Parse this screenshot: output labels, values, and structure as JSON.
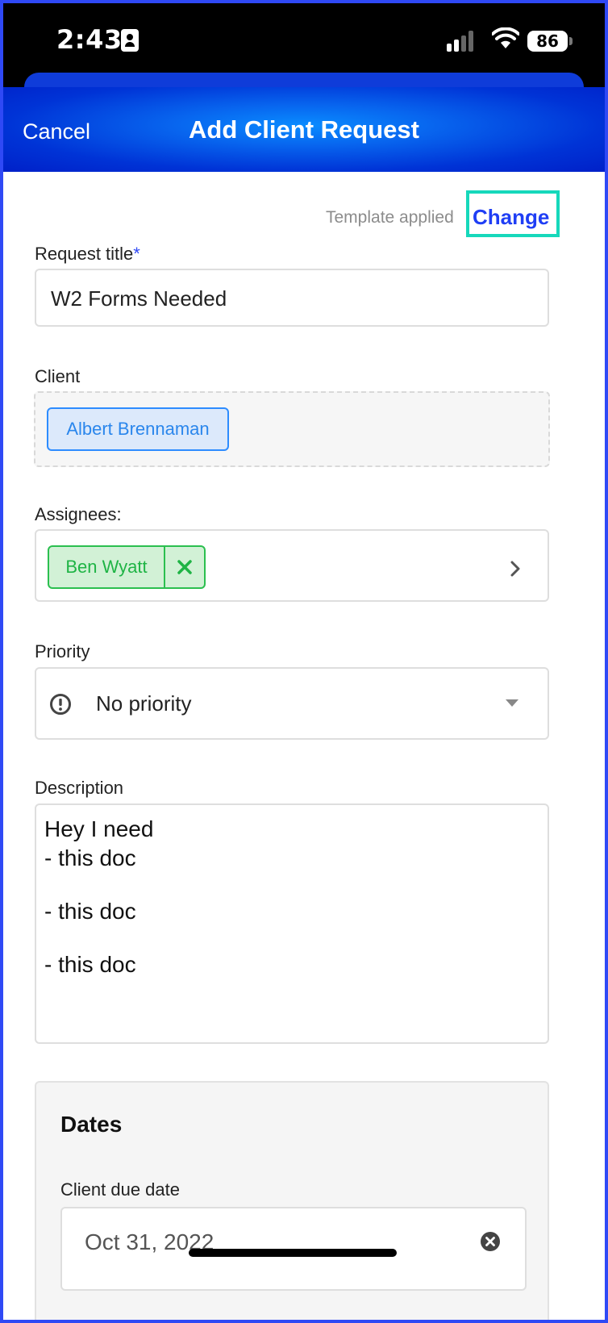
{
  "status_bar": {
    "time": "2:43",
    "battery": "86"
  },
  "header": {
    "cancel_label": "Cancel",
    "title": "Add Client Request"
  },
  "template": {
    "applied_text": "Template applied",
    "change_label": "Change"
  },
  "request_title": {
    "label": "Request title",
    "required_mark": "*",
    "value": "W2 Forms Needed"
  },
  "client": {
    "label": "Client",
    "selected": "Albert Brennaman"
  },
  "assignees": {
    "label": "Assignees:",
    "items": [
      {
        "name": "Ben Wyatt"
      }
    ]
  },
  "priority": {
    "label": "Priority",
    "value": "No priority"
  },
  "description": {
    "label": "Description",
    "lines": [
      "Hey I need",
      "- this doc",
      "",
      "- this doc",
      "",
      "- this doc"
    ]
  },
  "dates": {
    "title": "Dates",
    "client_due_label": "Client due date",
    "client_due_value": "Oct 31, 2022"
  },
  "colors": {
    "accent": "#1f3ef5",
    "highlight": "#16d8bb",
    "chip_blue": "#2d8cff",
    "chip_green": "#2bbf4f"
  }
}
